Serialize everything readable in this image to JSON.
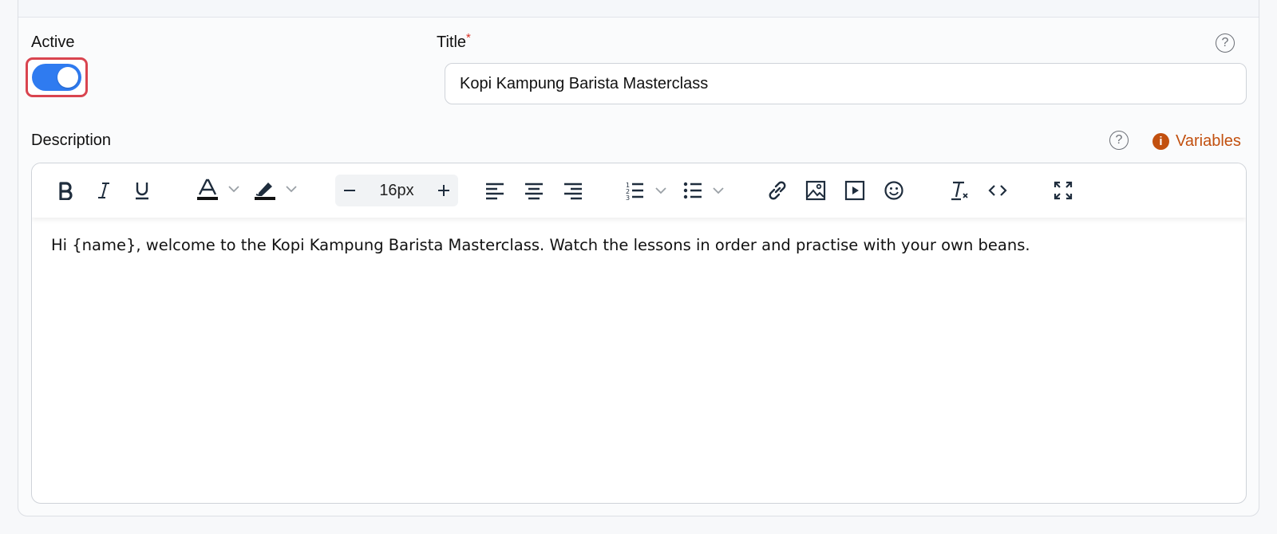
{
  "form": {
    "active_label": "Active",
    "active_state": "on",
    "title_label": "Title",
    "title_required_mark": "*",
    "title_value": "Kopi Kampung Barista Masterclass",
    "description_label": "Description",
    "help_glyph": "?",
    "variables_label": "Variables",
    "variables_icon": "i"
  },
  "editor": {
    "toolbar": {
      "font_size": "16px",
      "buttons": [
        "bold",
        "italic",
        "underline",
        "text-color",
        "highlight-color",
        "decrease-font-size",
        "increase-font-size",
        "align-left",
        "align-center",
        "align-right",
        "ordered-list",
        "bullet-list",
        "link",
        "image",
        "video",
        "emoji",
        "clear-format",
        "code-view",
        "fullscreen"
      ]
    },
    "content": "Hi {name}, welcome to the Kopi Kampung Barista Masterclass. Watch the lessons in order and practise with your own beans."
  },
  "colors": {
    "accent": "#2f7bf0",
    "highlight_border": "#d9444f",
    "variables": "#c2500f",
    "required": "#d93025"
  }
}
